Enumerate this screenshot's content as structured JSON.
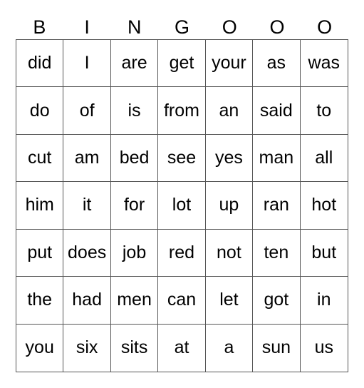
{
  "header": [
    "B",
    "I",
    "N",
    "G",
    "O",
    "O",
    "O"
  ],
  "rows": [
    [
      "did",
      "I",
      "are",
      "get",
      "your",
      "as",
      "was"
    ],
    [
      "do",
      "of",
      "is",
      "from",
      "an",
      "said",
      "to"
    ],
    [
      "cut",
      "am",
      "bed",
      "see",
      "yes",
      "man",
      "all"
    ],
    [
      "him",
      "it",
      "for",
      "lot",
      "up",
      "ran",
      "hot"
    ],
    [
      "put",
      "does",
      "job",
      "red",
      "not",
      "ten",
      "but"
    ],
    [
      "the",
      "had",
      "men",
      "can",
      "let",
      "got",
      "in"
    ],
    [
      "you",
      "six",
      "sits",
      "at",
      "a",
      "sun",
      "us"
    ]
  ]
}
